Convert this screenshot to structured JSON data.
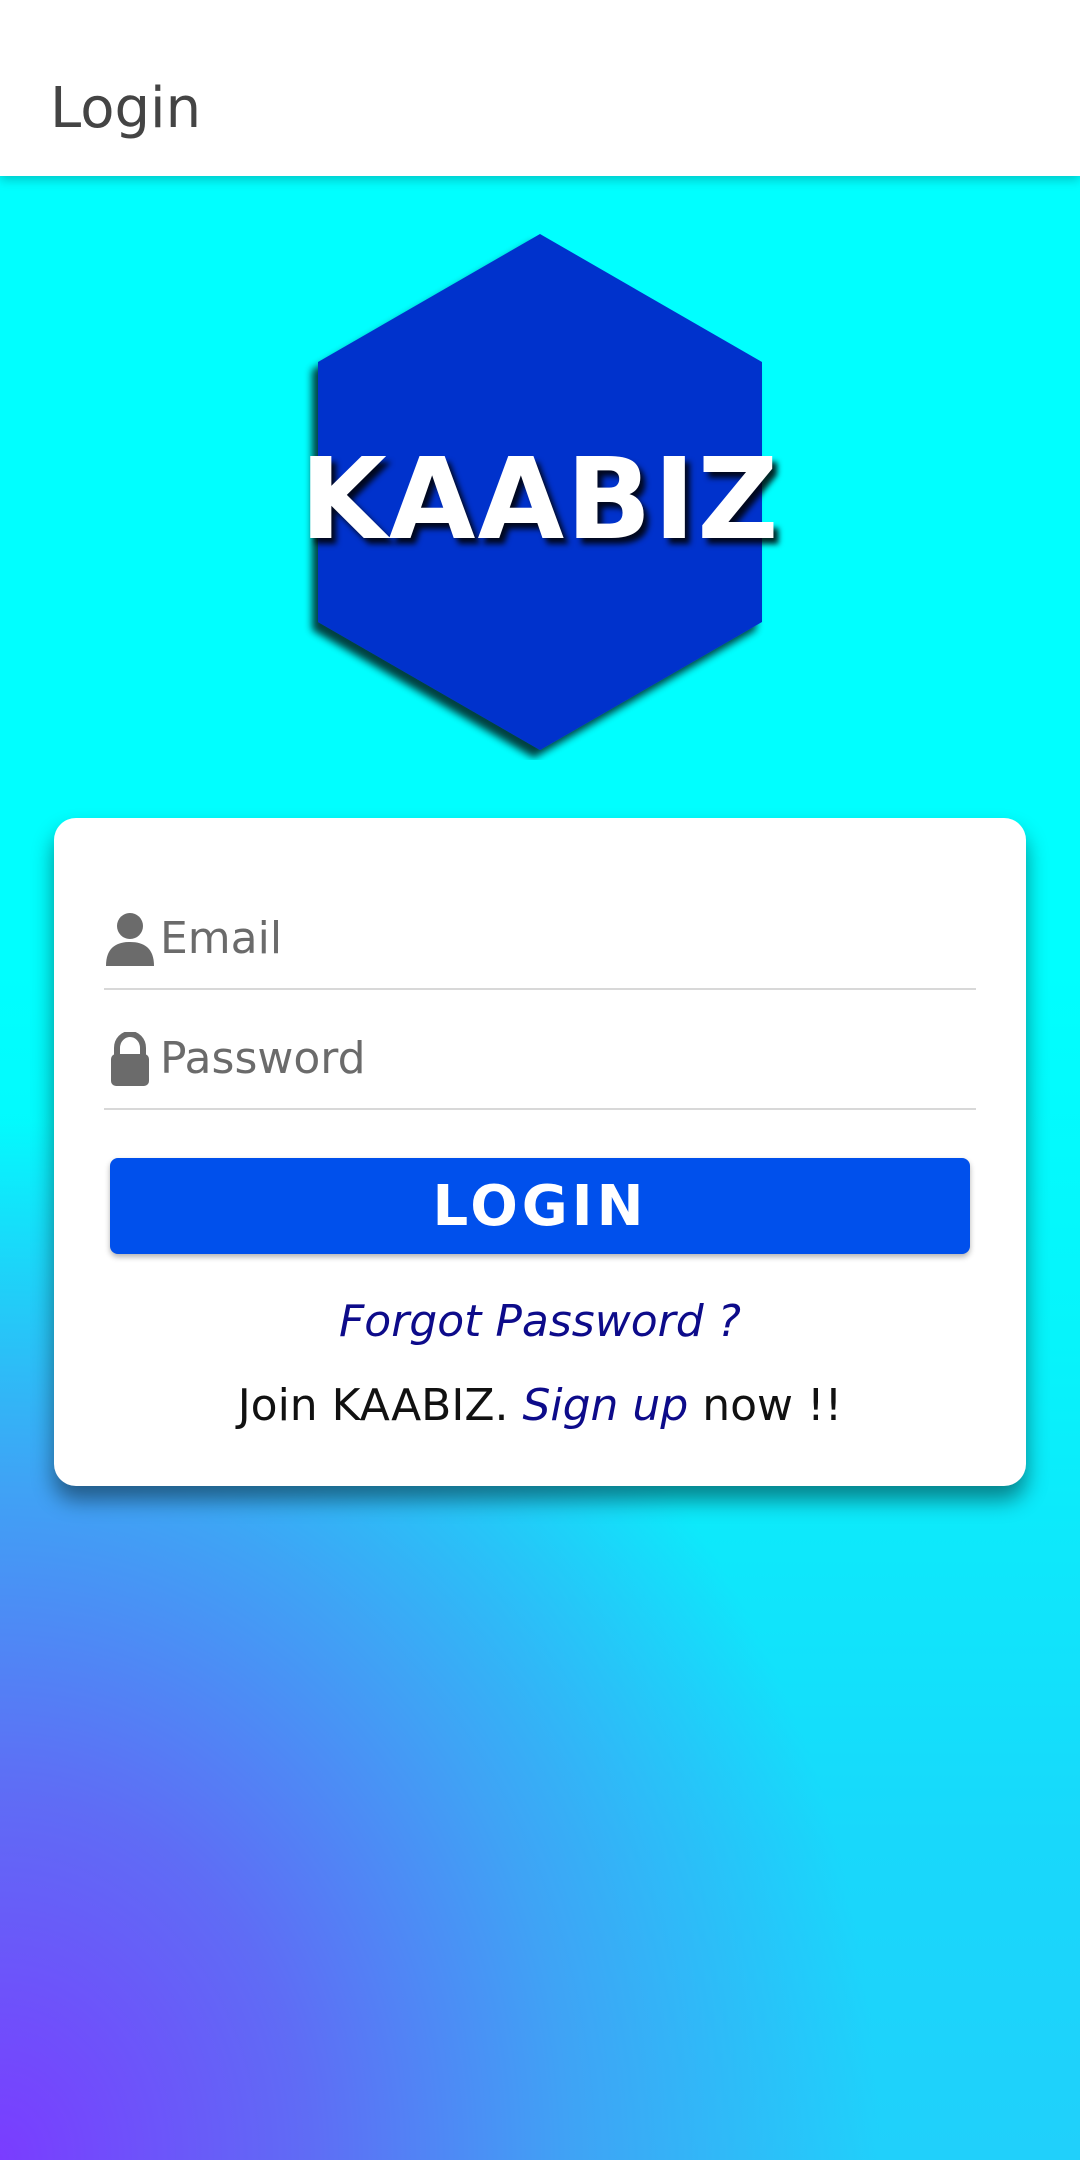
{
  "app_bar": {
    "title": "Login"
  },
  "logo": {
    "text": "KAABIZ",
    "shape": "hexagon",
    "fill_color": "#0033cc"
  },
  "login_form": {
    "email": {
      "placeholder": "Email",
      "value": "",
      "icon": "person-icon"
    },
    "password": {
      "placeholder": "Password",
      "value": "",
      "icon": "lock-icon"
    },
    "login_button_label": "LOGIN",
    "forgot_password_label": "Forgot Password ?",
    "signup": {
      "prefix": "Join KAABIZ. ",
      "link_label": "Sign up",
      "suffix": " now !!"
    }
  },
  "colors": {
    "app_bar_bg": "#ffffff",
    "primary_button": "#0050ec",
    "link": "#0d0b8a",
    "background_top": "#00ffff",
    "background_bottom_left": "#7a3cff"
  }
}
